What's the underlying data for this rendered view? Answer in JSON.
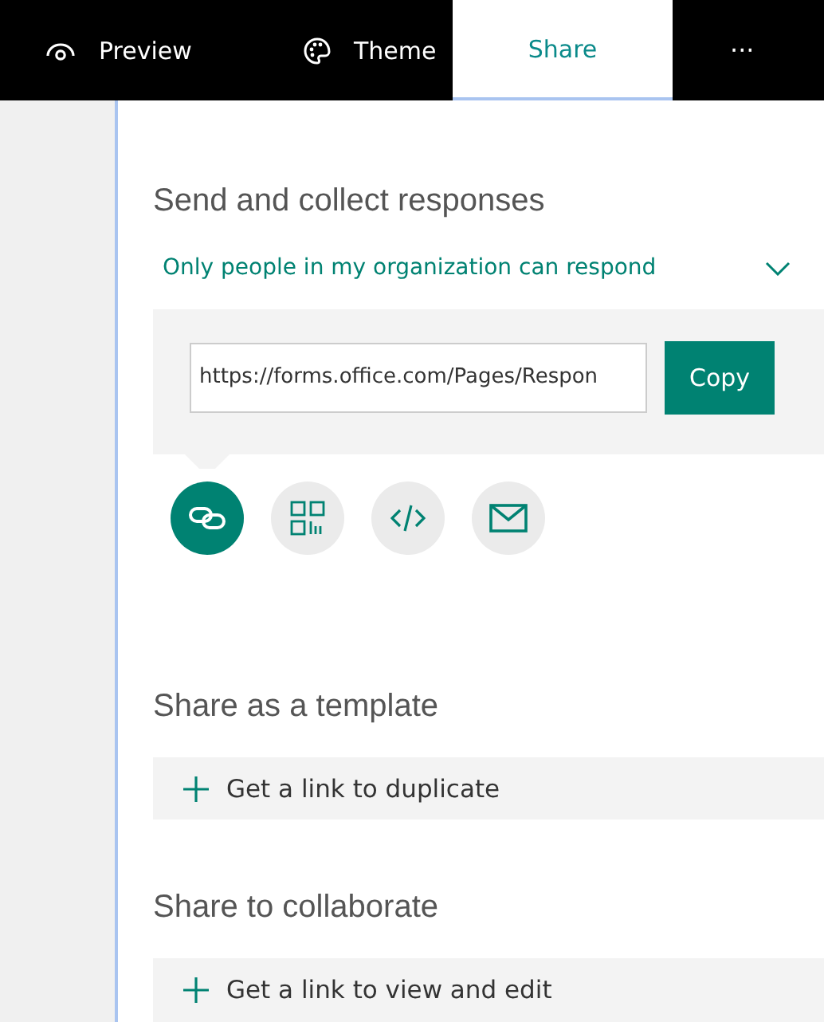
{
  "tabs": [
    {
      "label": "Preview",
      "kind": "eye",
      "selected": false
    },
    {
      "label": "Theme",
      "kind": "palette",
      "selected": false
    },
    {
      "label": "Share",
      "kind": "none",
      "selected": true
    },
    {
      "label": "···",
      "kind": "none",
      "selected": false
    }
  ],
  "send": {
    "heading": "Send and collect responses",
    "audience": "Only people in my organization can respond",
    "link_value": "https://forms.office.com/Pages/Respon",
    "copy_button": "Copy",
    "methods": [
      {
        "kind": "link",
        "selected": true
      },
      {
        "kind": "qr",
        "selected": false
      },
      {
        "kind": "embed",
        "selected": false
      },
      {
        "kind": "email",
        "selected": false
      }
    ]
  },
  "sections": [
    {
      "heading": "Share as a template",
      "action": "Get a link to duplicate"
    },
    {
      "heading": "Share to collaborate",
      "action": "Get a link to view and edit"
    }
  ]
}
